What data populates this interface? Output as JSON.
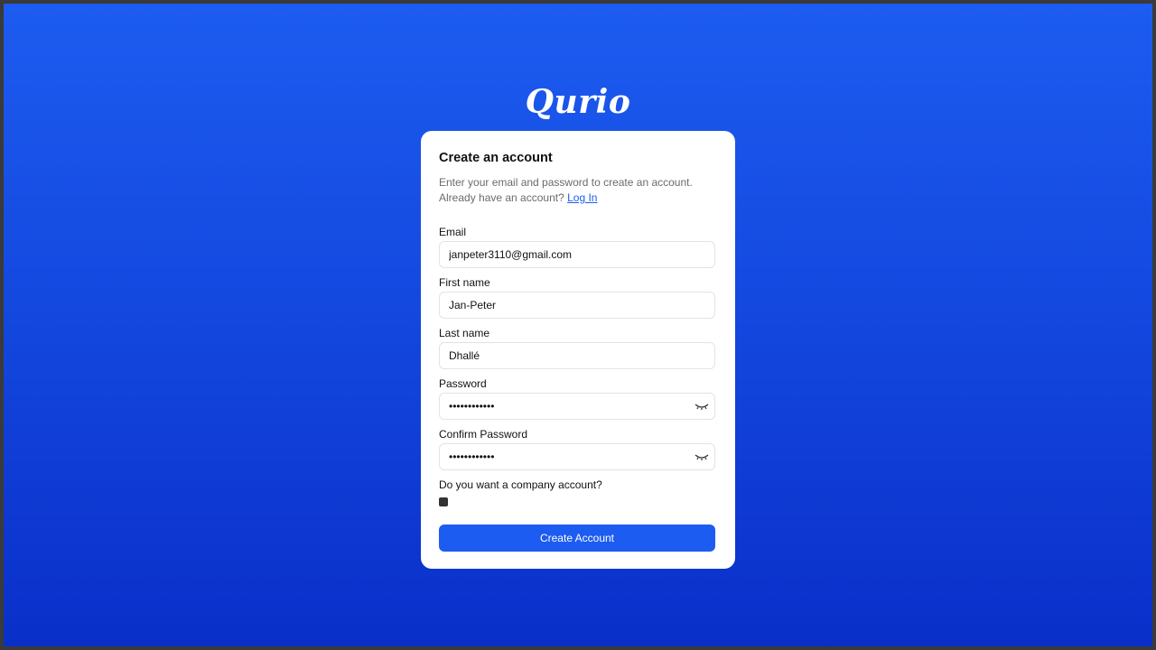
{
  "logo": "Qurio",
  "card": {
    "title": "Create an account",
    "desc_line1": "Enter your email and password to create an account.",
    "desc_line2": "Already have an account?",
    "login_link": "Log In"
  },
  "form": {
    "email": {
      "label": "Email",
      "value": "janpeter3110@gmail.com"
    },
    "first_name": {
      "label": "First name",
      "value": "Jan-Peter"
    },
    "last_name": {
      "label": "Last name",
      "value": "Dhallé"
    },
    "password": {
      "label": "Password",
      "value": "••••••••••••"
    },
    "confirm_password": {
      "label": "Confirm Password",
      "value": "••••••••••••"
    },
    "company_question": "Do you want a company account?",
    "company_checked": true,
    "submit_label": "Create Account"
  },
  "colors": {
    "accent": "#1d5cf0",
    "background_top": "#1d5cf0",
    "background_bottom": "#0a2fc9"
  },
  "icons": {
    "password_toggle": "eye-closed-icon"
  }
}
